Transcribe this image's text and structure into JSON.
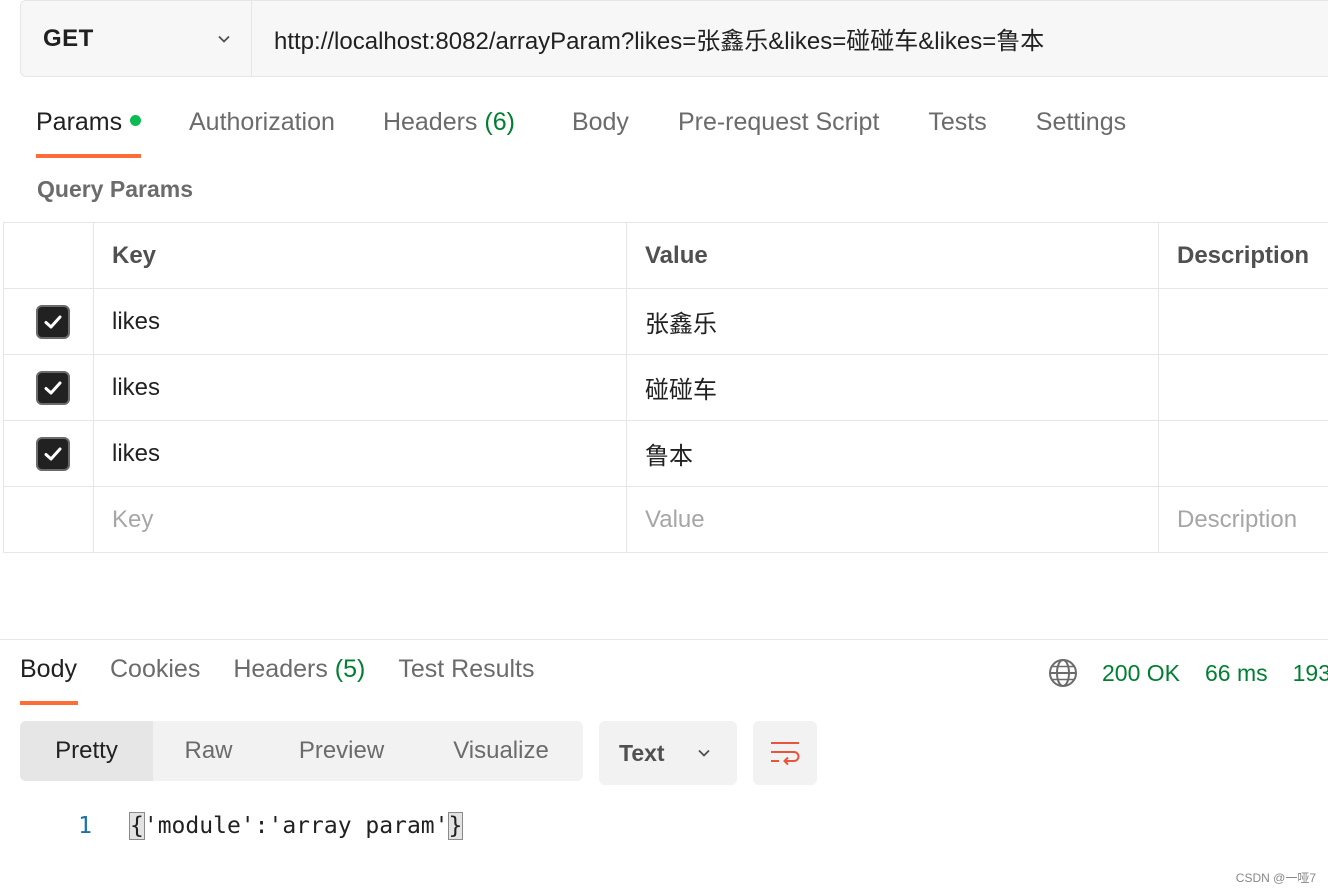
{
  "request": {
    "method": "GET",
    "url": "http://localhost:8082/arrayParam?likes=张鑫乐&likes=碰碰车&likes=鲁本"
  },
  "request_tabs": [
    {
      "label": "Params",
      "active": true,
      "dot": true
    },
    {
      "label": "Authorization"
    },
    {
      "label": "Headers",
      "count": "(6)"
    },
    {
      "label": "Body"
    },
    {
      "label": "Pre-request Script"
    },
    {
      "label": "Tests"
    },
    {
      "label": "Settings"
    }
  ],
  "query_params": {
    "title": "Query Params",
    "columns": [
      "Key",
      "Value",
      "Description"
    ],
    "rows": [
      {
        "checked": true,
        "key": "likes",
        "value": "张鑫乐",
        "description": ""
      },
      {
        "checked": true,
        "key": "likes",
        "value": "碰碰车",
        "description": ""
      },
      {
        "checked": true,
        "key": "likes",
        "value": "鲁本",
        "description": ""
      }
    ],
    "placeholder": {
      "key": "Key",
      "value": "Value",
      "description": "Description"
    }
  },
  "response_tabs": [
    {
      "label": "Body",
      "active": true
    },
    {
      "label": "Cookies"
    },
    {
      "label": "Headers",
      "count": "(5)"
    },
    {
      "label": "Test Results"
    }
  ],
  "response_status": {
    "status": "200 OK",
    "time": "66 ms",
    "size": "193"
  },
  "view_modes": [
    "Pretty",
    "Raw",
    "Preview",
    "Visualize"
  ],
  "format": "Text",
  "code": {
    "line_number": "1",
    "open_brace": "{",
    "content": "'module':'array param'",
    "close_brace": "}"
  },
  "watermark": "CSDN @一哑7",
  "colors": {
    "accent": "#ff6c37",
    "success": "#007f31",
    "dot": "#0cbb52"
  }
}
